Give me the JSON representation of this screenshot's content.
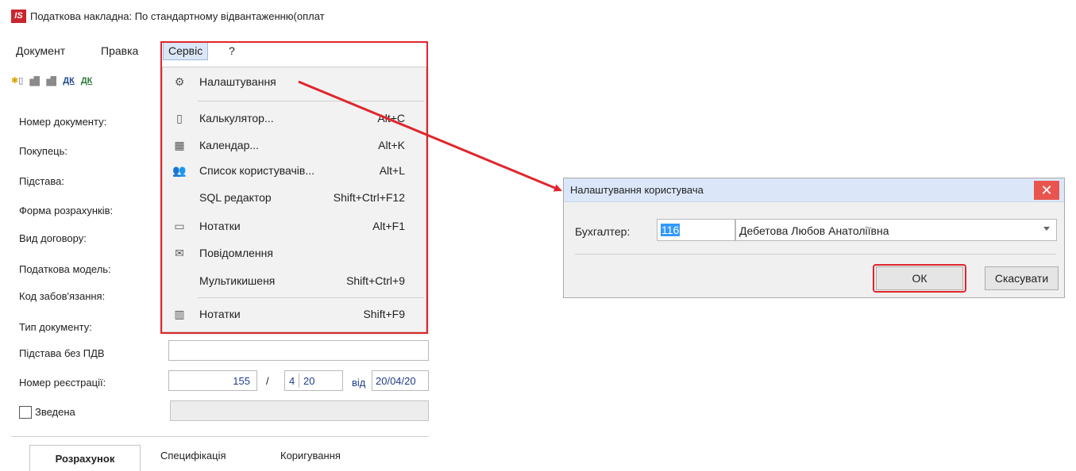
{
  "window": {
    "title": "Податкова накладна: По стандартному відвантаженню(оплат",
    "logo": "IS"
  },
  "menu": {
    "document": "Документ",
    "edit": "Правка",
    "service": "Сервіс",
    "help": "?"
  },
  "toolbar": {
    "dk1": "ДК",
    "dk2": "ДК"
  },
  "form": {
    "labels": {
      "doc_number": "Номер документу:",
      "buyer": "Покупець:",
      "basis": "Підстава:",
      "payment_form": "Форма розрахунків:",
      "contract_type": "Вид договору:",
      "tax_model": "Податкова модель:",
      "obligation_code": "Код забов'язання:",
      "doc_type": "Тип документу:",
      "basis_no_vat": "Підстава без ПДВ",
      "registration_number": "Номер реєстрації:",
      "consolidated": "Зведена"
    },
    "registration": {
      "number": "155",
      "separator": "/",
      "part1": "4",
      "part2": "20",
      "from_label": "від",
      "date": "20/04/20"
    }
  },
  "tabs": [
    {
      "label": "Розрахунок"
    },
    {
      "label": "Специфікація"
    },
    {
      "label": "Коригування"
    }
  ],
  "service_menu": {
    "items": [
      {
        "icon": "gears-icon",
        "label": "Налаштування",
        "shortcut": ""
      },
      {
        "icon": "calculator-icon",
        "label": "Калькулятор...",
        "shortcut": "Alt+C"
      },
      {
        "icon": "calendar-icon",
        "label": "Календар...",
        "shortcut": "Alt+K"
      },
      {
        "icon": "users-icon",
        "label": "Список користувачів...",
        "shortcut": "Alt+L"
      },
      {
        "icon": "",
        "label": "SQL редактор",
        "shortcut": "Shift+Ctrl+F12"
      },
      {
        "icon": "note-icon",
        "label": "Нотатки",
        "shortcut": "Alt+F1"
      },
      {
        "icon": "envelope-icon",
        "label": "Повідомлення",
        "shortcut": ""
      },
      {
        "icon": "",
        "label": "Мультикишеня",
        "shortcut": "Shift+Ctrl+9"
      },
      {
        "icon": "notes-grid-icon",
        "label": "Нотатки",
        "shortcut": "Shift+F9"
      }
    ]
  },
  "dialog": {
    "title": "Налаштування користувача",
    "close": "✕",
    "accountant_label": "Бухгалтер:",
    "accountant_code": "116",
    "accountant_name": "Дебетова Любов Анатоліївна",
    "ok_label": "ОК",
    "cancel_label": "Скасувати"
  },
  "colors": {
    "highlight": "#e0262d",
    "dialog_title_bg": "#dbe7f8",
    "selection": "#3399ff",
    "close_button": "#e8554f"
  }
}
